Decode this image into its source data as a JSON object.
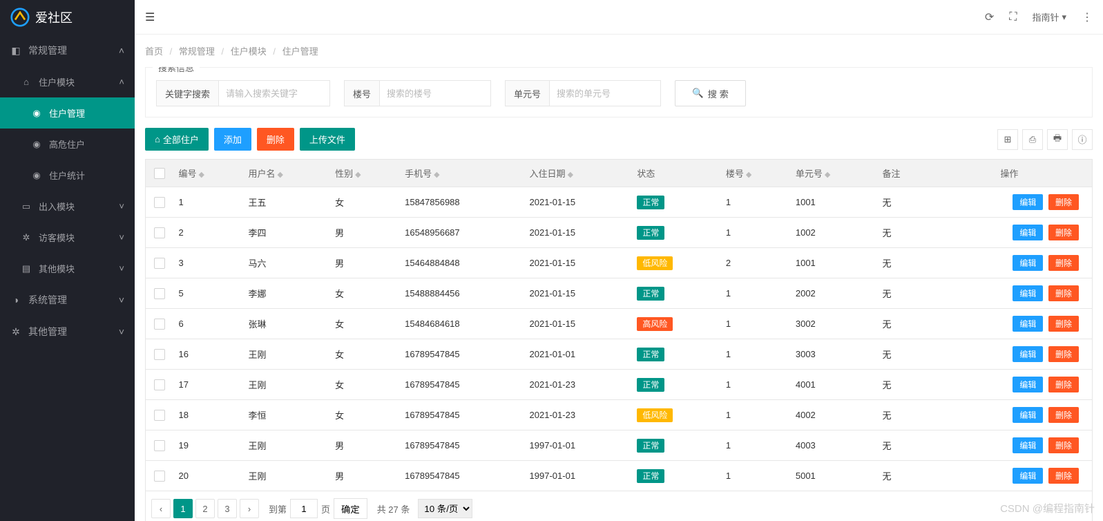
{
  "app": {
    "name": "爱社区"
  },
  "topbar": {
    "compass": "指南针"
  },
  "breadcrumb": {
    "home": "首页",
    "l1": "常规管理",
    "l2": "住户模块",
    "l3": "住户管理"
  },
  "sidebar": {
    "regular": "常规管理",
    "resident_module": "住户模块",
    "resident_mgmt": "住户管理",
    "high_risk": "高危住户",
    "resident_stats": "住户统计",
    "access_module": "出入模块",
    "visitor_module": "访客模块",
    "other_module": "其他模块",
    "system_mgmt": "系统管理",
    "other_mgmt": "其他管理"
  },
  "search": {
    "legend": "搜索信息",
    "keyword_label": "关键字搜索",
    "keyword_ph": "请输入搜索关键字",
    "building_label": "楼号",
    "building_ph": "搜索的楼号",
    "unit_label": "单元号",
    "unit_ph": "搜索的单元号",
    "button": "搜 索"
  },
  "actions": {
    "all": "全部住户",
    "add": "添加",
    "delete": "删除",
    "upload": "上传文件"
  },
  "columns": {
    "id": "编号",
    "name": "用户名",
    "gender": "性别",
    "phone": "手机号",
    "date": "入住日期",
    "status": "状态",
    "building": "楼号",
    "unit": "单元号",
    "remark": "备注",
    "op": "操作"
  },
  "row_actions": {
    "edit": "编辑",
    "delete": "删除"
  },
  "status_labels": {
    "normal": "正常",
    "low": "低风险",
    "high": "高风险"
  },
  "rows": [
    {
      "id": "1",
      "name": "王五",
      "gender": "女",
      "phone": "15847856988",
      "date": "2021-01-15",
      "status": "normal",
      "building": "1",
      "unit": "1001",
      "remark": "无"
    },
    {
      "id": "2",
      "name": "李四",
      "gender": "男",
      "phone": "16548956687",
      "date": "2021-01-15",
      "status": "normal",
      "building": "1",
      "unit": "1002",
      "remark": "无"
    },
    {
      "id": "3",
      "name": "马六",
      "gender": "男",
      "phone": "15464884848",
      "date": "2021-01-15",
      "status": "low",
      "building": "2",
      "unit": "1001",
      "remark": "无"
    },
    {
      "id": "5",
      "name": "李娜",
      "gender": "女",
      "phone": "15488884456",
      "date": "2021-01-15",
      "status": "normal",
      "building": "1",
      "unit": "2002",
      "remark": "无"
    },
    {
      "id": "6",
      "name": "张琳",
      "gender": "女",
      "phone": "15484684618",
      "date": "2021-01-15",
      "status": "high",
      "building": "1",
      "unit": "3002",
      "remark": "无"
    },
    {
      "id": "16",
      "name": "王刚",
      "gender": "女",
      "phone": "16789547845",
      "date": "2021-01-01",
      "status": "normal",
      "building": "1",
      "unit": "3003",
      "remark": "无"
    },
    {
      "id": "17",
      "name": "王刚",
      "gender": "女",
      "phone": "16789547845",
      "date": "2021-01-23",
      "status": "normal",
      "building": "1",
      "unit": "4001",
      "remark": "无"
    },
    {
      "id": "18",
      "name": "李恒",
      "gender": "女",
      "phone": "16789547845",
      "date": "2021-01-23",
      "status": "low",
      "building": "1",
      "unit": "4002",
      "remark": "无"
    },
    {
      "id": "19",
      "name": "王刚",
      "gender": "男",
      "phone": "16789547845",
      "date": "1997-01-01",
      "status": "normal",
      "building": "1",
      "unit": "4003",
      "remark": "无"
    },
    {
      "id": "20",
      "name": "王刚",
      "gender": "男",
      "phone": "16789547845",
      "date": "1997-01-01",
      "status": "normal",
      "building": "1",
      "unit": "5001",
      "remark": "无"
    }
  ],
  "pagination": {
    "pages": [
      "1",
      "2",
      "3"
    ],
    "active": "1",
    "jump_label_pre": "到第",
    "jump_value": "1",
    "jump_label_post": "页",
    "confirm": "确定",
    "total": "共 27 条",
    "size": "10 条/页"
  },
  "watermark": "CSDN @编程指南针"
}
